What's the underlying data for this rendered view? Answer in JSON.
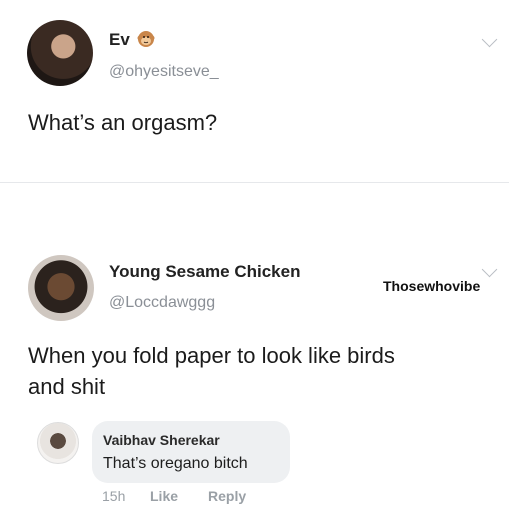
{
  "tweet1": {
    "name": "Ev",
    "emoji_icon": "monkey-face-icon",
    "handle": "@ohyesitseve_",
    "text": "What’s an orgasm?"
  },
  "tweet2": {
    "name": "Young Sesame Chicken",
    "handle": "@Loccdawggg",
    "text_line1": "When you fold paper to look like birds",
    "text_line2": "and shit"
  },
  "watermark": "Thosewhovibe",
  "comment": {
    "name": "Vaibhav Sherekar",
    "text": "That’s oregano bitch",
    "time": "15h",
    "like": "Like",
    "reply": "Reply"
  }
}
